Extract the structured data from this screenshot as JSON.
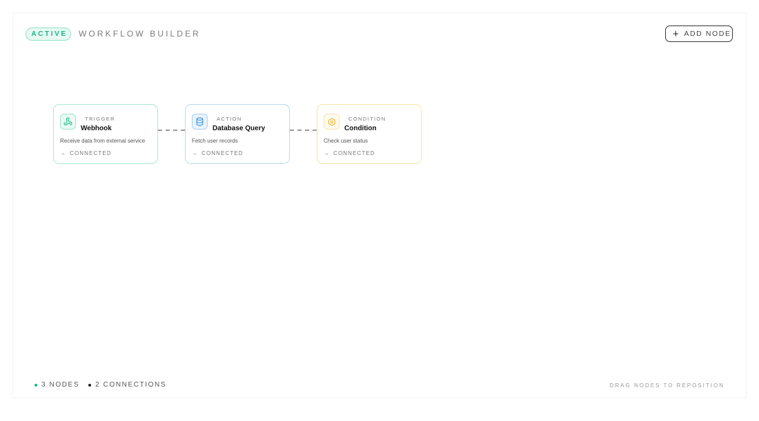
{
  "header": {
    "status_badge": "ACTIVE",
    "title": "WORKFLOW BUILDER",
    "add_node_label": "ADD NODE"
  },
  "nodes": [
    {
      "type": "TRIGGER",
      "name": "Webhook",
      "description": "Receive data from external service",
      "status": "CONNECTED",
      "icon": "webhook-icon",
      "accent": "#12b886"
    },
    {
      "type": "ACTION",
      "name": "Database Query",
      "description": "Fetch user records",
      "status": "CONNECTED",
      "icon": "database-icon",
      "accent": "#3b8fd6"
    },
    {
      "type": "CONDITION",
      "name": "Condition",
      "description": "Check user status",
      "status": "CONNECTED",
      "icon": "hexagon-gear-icon",
      "accent": "#f2b824"
    }
  ],
  "footer": {
    "nodes_count": "3 NODES",
    "connections_count": "2 CONNECTIONS",
    "hint": "DRAG NODES TO REPOSITION"
  },
  "colors": {
    "active_green": "#12b886",
    "action_blue": "#3b8fd6",
    "condition_yellow": "#f2b824"
  }
}
